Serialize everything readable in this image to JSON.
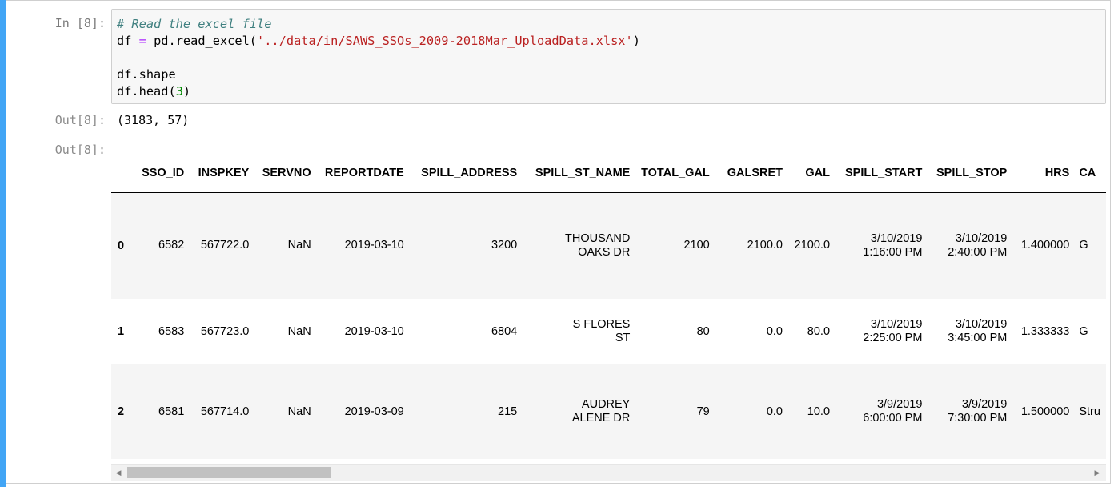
{
  "input_cell": {
    "prompt": "In [8]:",
    "code": {
      "comment": "# Read the excel file",
      "line2_pre": "df ",
      "line2_eq": "=",
      "line2_call": " pd.read_excel(",
      "line2_str": "'../data/in/SAWS_SSOs_2009-2018Mar_UploadData.xlsx'",
      "line2_close": ")",
      "line4": "df.shape",
      "line5_pre": "df.head(",
      "line5_num": "3",
      "line5_close": ")"
    }
  },
  "output_shape": {
    "prompt": "Out[8]:",
    "text": "(3183, 57)"
  },
  "output_table": {
    "prompt": "Out[8]:",
    "columns": [
      "SSO_ID",
      "INSPKEY",
      "SERVNO",
      "REPORTDATE",
      "SPILL_ADDRESS",
      "SPILL_ST_NAME",
      "TOTAL_GAL",
      "GALSRET",
      "GAL",
      "SPILL_START",
      "SPILL_STOP",
      "HRS",
      "CA"
    ],
    "rows": [
      {
        "index": "0",
        "cells": [
          "6582",
          "567722.0",
          "NaN",
          "2019-03-10",
          "3200",
          "THOUSAND OAKS DR",
          "2100",
          "2100.0",
          "2100.0",
          "3/10/2019 1:16:00 PM",
          "3/10/2019 2:40:00 PM",
          "1.400000",
          "G"
        ]
      },
      {
        "index": "1",
        "cells": [
          "6583",
          "567723.0",
          "NaN",
          "2019-03-10",
          "6804",
          "S FLORES ST",
          "80",
          "0.0",
          "80.0",
          "3/10/2019 2:25:00 PM",
          "3/10/2019 3:45:00 PM",
          "1.333333",
          "G"
        ]
      },
      {
        "index": "2",
        "cells": [
          "6581",
          "567714.0",
          "NaN",
          "2019-03-09",
          "215",
          "AUDREY ALENE DR",
          "79",
          "0.0",
          "10.0",
          "3/9/2019 6:00:00 PM",
          "3/9/2019 7:30:00 PM",
          "1.500000",
          "Stru"
        ]
      }
    ]
  },
  "scrollbar": {
    "left_arrow": "◀",
    "right_arrow": "▶",
    "position_fraction": 0.0
  },
  "colors": {
    "selection_bar": "#42a5f5",
    "input_background": "#f7f7f7",
    "comment": "#408080",
    "string": "#ba2121",
    "number": "#008800"
  }
}
